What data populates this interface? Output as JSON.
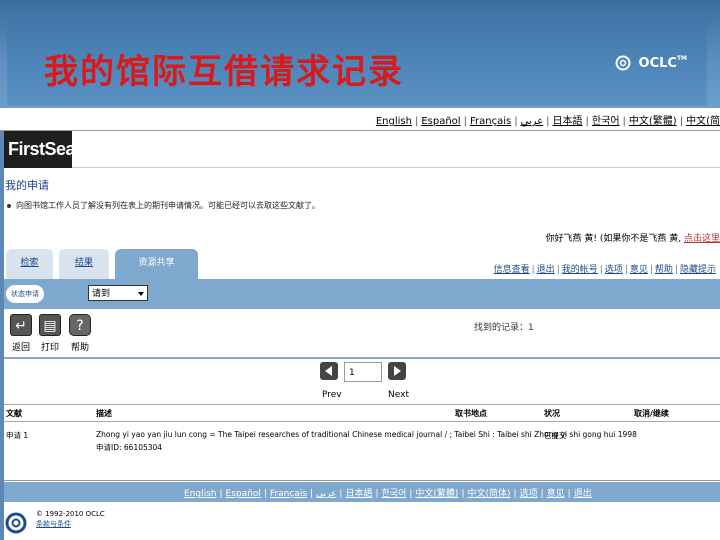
{
  "slide": {
    "title": "我的馆际互借请求记录",
    "brand": "OCLC",
    "brand_tm": "TM"
  },
  "lang_top": [
    "English",
    "Español",
    "Français",
    "عربي",
    "日本語",
    "한국어",
    "中文(繁體)",
    "中文(简"
  ],
  "app": {
    "logo": "FirstSearch",
    "section_title": "我的申请",
    "notice": "向图书馆工作人员了解没有列在表上的期刊申请情况。可能已经可以去取这些文献了。",
    "greeting_prefix": "你好",
    "greeting_name": "飞燕 黄",
    "greeting_mid": "! (如果你不是",
    "greeting_name2": "飞燕 黄",
    "greeting_comma": ",",
    "greeting_link": "点击这里"
  },
  "tabs": {
    "search": "检索",
    "results": "结果",
    "resource_sharing": "资源共享"
  },
  "nav_right": [
    "信息查看",
    "退出",
    "我的帐号",
    "选项",
    "意见",
    "帮助",
    "隐藏提示"
  ],
  "band": {
    "filter_label": "状态申请",
    "status_value": "请到"
  },
  "toolbar": {
    "back": "返回",
    "print": "打印",
    "help": "帮助",
    "found_records": "找到的记录：1"
  },
  "pager": {
    "page_value": "1",
    "prev": "Prev",
    "next": "Next"
  },
  "table": {
    "headers": {
      "no": "文献",
      "description": "描述",
      "pickup": "取书地点",
      "status": "状况",
      "cancel": "取消/继续"
    },
    "rows": [
      {
        "no": "申请 1",
        "description_line1": "Zhong yi yao yan jiu lun cong = The Taipei researches of traditional Chinese medical journal / ; Taibei Shi : Taibei shi Zhong yi shi gong hui 1998",
        "description_line2": "申请ID: 66105304",
        "pickup": "",
        "status": "已提交",
        "cancel": ""
      }
    ]
  },
  "lang_bottom": [
    "English",
    "Español",
    "Français",
    "عربي",
    "日本語",
    "한국어",
    "中文(繁體)",
    "中文(简体)",
    "选项",
    "意见",
    "退出"
  ],
  "footer": {
    "copyright": "© 1992-2010 OCLC",
    "link": "条款与条件"
  }
}
